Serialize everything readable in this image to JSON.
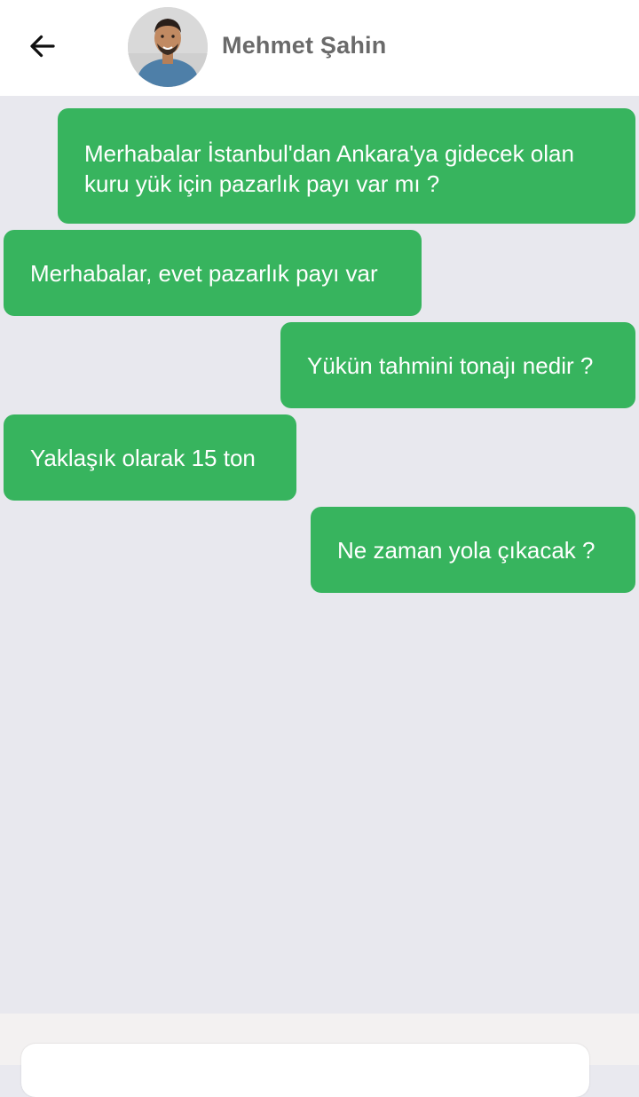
{
  "header": {
    "contact_name": "Mehmet Şahin",
    "back_icon": "arrow-left-icon",
    "avatar": "contact-avatar"
  },
  "messages": [
    {
      "side": "outgoing",
      "text": "Merhabalar İstanbul'dan Ankara'ya gidecek olan kuru yük için pazarlık payı var mı ?"
    },
    {
      "side": "incoming",
      "text": "Merhabalar, evet pazarlık payı var"
    },
    {
      "side": "outgoing",
      "text": "Yükün tahmini tonajı nedir ?"
    },
    {
      "side": "incoming",
      "text": "Yaklaşık olarak 15 ton"
    },
    {
      "side": "outgoing",
      "text": "Ne zaman yola çıkacak ?"
    }
  ],
  "composer": {
    "value": "",
    "placeholder": ""
  },
  "colors": {
    "bubble": "#37b45e",
    "chat_background": "#e8e8ee",
    "header_background": "#ffffff",
    "name_text": "#6a6a6a"
  }
}
